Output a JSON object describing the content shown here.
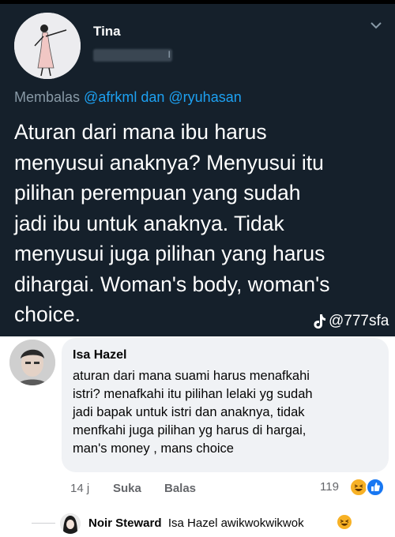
{
  "tweet": {
    "display_name": "Tina",
    "handle_tail": "ı",
    "reply_prefix": "Membalas",
    "mention_1": "@afrkml",
    "reply_joiner": "dan",
    "mention_2": "@ryuhasan",
    "lines": [
      "Aturan dari mana ibu harus",
      "menyusui anaknya? Menyusui itu",
      "pilihan perempuan yang sudah",
      "jadi ibu untuk anaknya. Tidak",
      "menyusui juga pilihan yang harus",
      "dihargai. Woman's body, woman's",
      "choice."
    ],
    "watermark": "@777sfa",
    "colors": {
      "background": "#15202b",
      "mention": "#1da1f2",
      "muted": "#8899a6"
    }
  },
  "comment": {
    "author": "Isa Hazel",
    "lines": [
      "aturan dari mana suami harus menafkahi",
      "istri? menafkahi itu pilihan lelaki yg sudah",
      "jadi bapak untuk istri dan anaknya, tidak",
      "menfkahi juga pilihan yg harus di hargai,",
      "man's money , mans choice"
    ],
    "time": "14 j",
    "like_label": "Suka",
    "reply_label": "Balas",
    "reaction_count": "119",
    "colors": {
      "bubble": "#f0f2f5",
      "muted": "#65676b"
    }
  },
  "reply": {
    "author": "Noir Steward",
    "text": "Isa Hazel awikwokwikwok"
  }
}
